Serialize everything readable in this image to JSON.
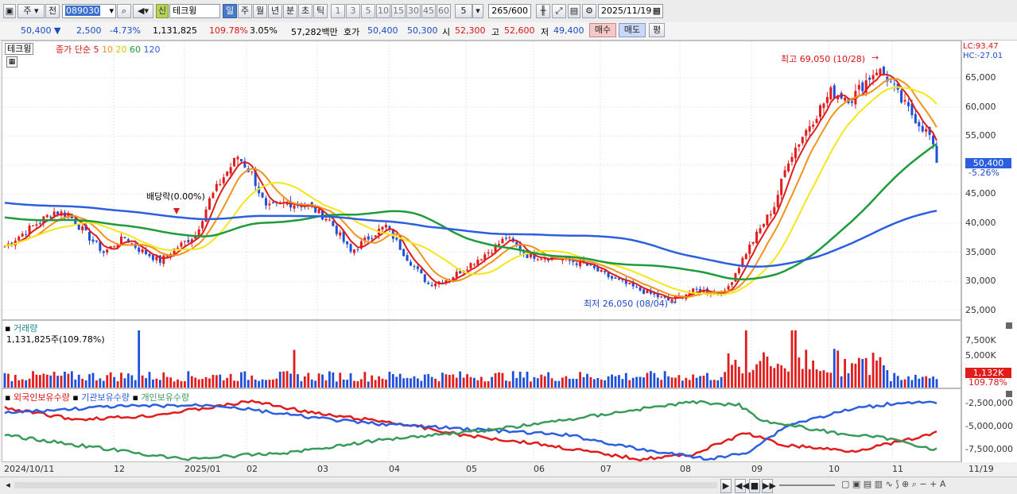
{
  "toolbar": {
    "market": "주",
    "prev_label": "전",
    "code": "089030",
    "name_badge": "신",
    "name": "테크윙",
    "periods": [
      "일",
      "주",
      "월",
      "년",
      "분",
      "초",
      "틱"
    ],
    "active_period": "일",
    "intervals": [
      "1",
      "3",
      "5",
      "10",
      "15",
      "30",
      "45",
      "60"
    ],
    "interval_value": "5",
    "count": "265",
    "count_total": "/600",
    "date": "2025/11/19"
  },
  "quote": {
    "price": "50,400",
    "change": "2,500",
    "change_pct": "-4.73%",
    "volume": "1,131,825",
    "volume_ratio": "109.78%",
    "turnover": "3.05%",
    "amount": "57,282백만",
    "bid_label": "호가",
    "ask": "50,400",
    "bid": "50,300",
    "open_label": "시",
    "open": "52,300",
    "high_label": "고",
    "high": "52,600",
    "low_label": "저",
    "low": "49,400",
    "buy_btn": "매수",
    "sell_btn": "매도",
    "eval_btn": "평"
  },
  "price_panel": {
    "title": "테크윙",
    "ma_legend": [
      "종가 단순",
      "5",
      "10",
      "20",
      "60",
      "120"
    ],
    "lc": "LC:93.47",
    "hc": "HC:-27.01",
    "high_note": "최고 69,050 (10/28)",
    "low_note": "최저 26,050 (08/04)",
    "dividend_note": "배당락(0.00%)",
    "current_price_tag": "50,400",
    "current_pct_tag": "-5.26%",
    "y_ticks": [
      "65,000",
      "60,000",
      "55,000",
      "50,000",
      "45,000",
      "40,000",
      "35,000",
      "30,000",
      "25,000"
    ]
  },
  "volume_panel": {
    "title": "거래량",
    "value": "1,131,825주(109.78%)",
    "y_ticks": [
      "7,500K",
      "5,000K"
    ],
    "tag_value": "1,132K",
    "tag_pct": "109.78%"
  },
  "holding_panel": {
    "legend": [
      "외국인보유수량",
      "기관보유수량",
      "개인보유수량"
    ],
    "y_ticks": [
      "-2,500,000",
      "-5,000,000",
      "-7,500,000"
    ]
  },
  "x_axis": [
    "2024/10/11",
    "12",
    "2025/01",
    "02",
    "03",
    "04",
    "05",
    "06",
    "07",
    "08",
    "09",
    "10",
    "11",
    "11/19"
  ],
  "colors": {
    "up": "#e01c1c",
    "down": "#1f4fd8",
    "ma5": "#e01c1c",
    "ma10": "#f2921c",
    "ma20": "#f5e61a",
    "ma60": "#1e9b3a",
    "ma120": "#2c5fe0",
    "foreign": "#e01c1c",
    "inst": "#2c5fe0",
    "indiv": "#3a9a5c"
  },
  "chart_data": {
    "type": "candlestick",
    "x_range": [
      "2024/10/11",
      "2025/11/19"
    ],
    "ylim": [
      25000,
      70000
    ],
    "high": {
      "label": "최고",
      "value": 69050,
      "date": "10/28"
    },
    "low": {
      "label": "최저",
      "value": 26050,
      "date": "08/04"
    },
    "last": {
      "close": 50400,
      "open": 52300,
      "high": 52600,
      "low": 49400
    }
  }
}
